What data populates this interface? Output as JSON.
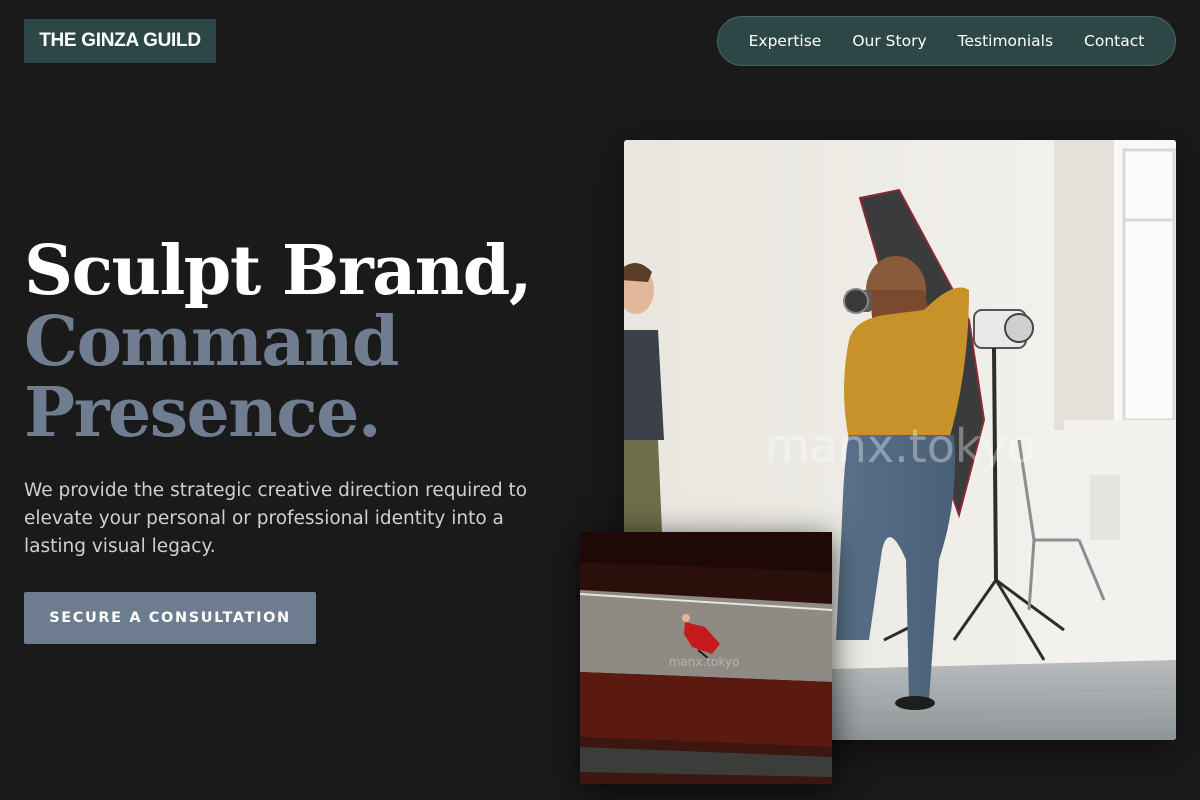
{
  "brand": {
    "logo_text": "THE GINZA GUILD"
  },
  "nav": {
    "items": [
      {
        "label": "Expertise"
      },
      {
        "label": "Our Story"
      },
      {
        "label": "Testimonials"
      },
      {
        "label": "Contact"
      }
    ]
  },
  "hero": {
    "headline_line1": "Sculpt Brand,",
    "headline_line2": "Command",
    "headline_line3": "Presence.",
    "subtext": "We provide the strategic creative direction required to elevate your personal or professional identity into a lasting visual legacy.",
    "cta_label": "SECURE A CONSULTATION"
  },
  "images": {
    "main_watermark": "manx.tokyo",
    "small_watermark": "manx.tokyo"
  },
  "colors": {
    "background": "#1a1a1b",
    "brand_teal": "#2d4747",
    "accent_slate": "#6e7c90",
    "headline_muted": "#707d91"
  }
}
